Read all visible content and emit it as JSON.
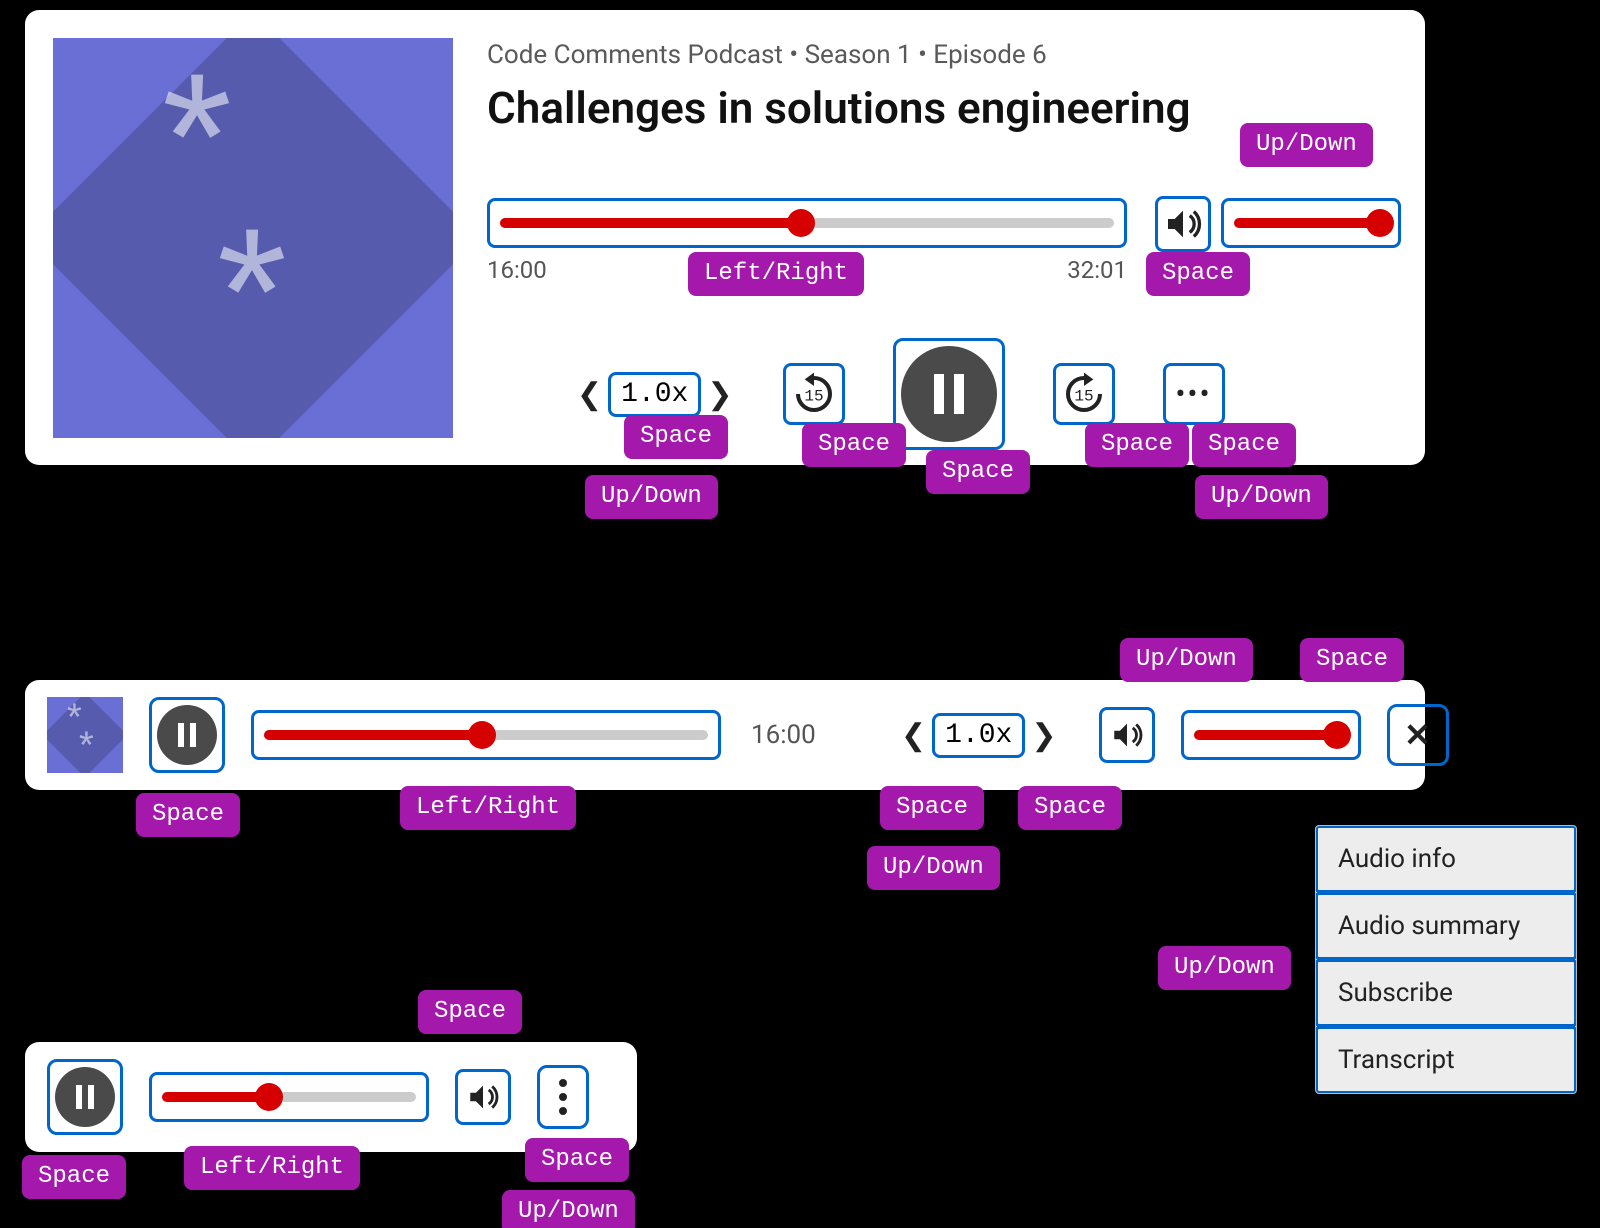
{
  "keys": {
    "space": "Space",
    "updown": "Up/Down",
    "leftright": "Left/Right"
  },
  "large": {
    "breadcrumb": "Code Comments Podcast • Season 1 • Episode 6",
    "title": "Challenges in solutions engineering",
    "elapsed": "16:00",
    "duration": "32:01",
    "speed": "1.0x",
    "skip_seconds": "15",
    "progress_pct": 49,
    "volume_pct": 95
  },
  "medium": {
    "elapsed": "16:00",
    "speed": "1.0x",
    "progress_pct": 49,
    "volume_pct": 93
  },
  "small": {
    "progress_pct": 42
  },
  "menu": {
    "items": [
      "Audio info",
      "Audio summary",
      "Subscribe",
      "Transcript"
    ]
  }
}
